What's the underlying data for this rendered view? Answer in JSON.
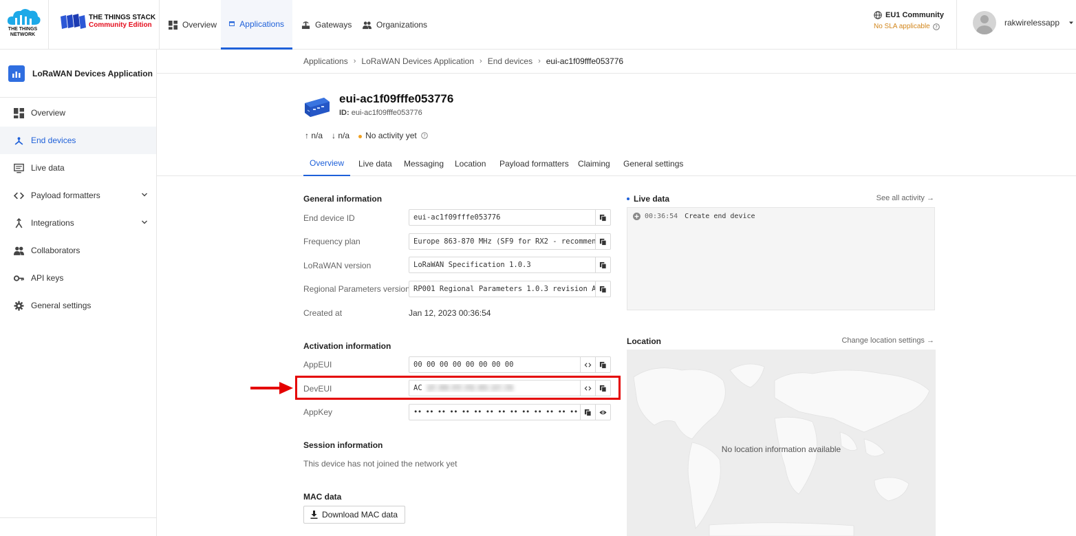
{
  "header": {
    "ttn_logo_text": "THE THINGS NETWORK",
    "stack_title": "THE THINGS STACK",
    "stack_edition": "Community Edition",
    "nav": [
      {
        "label": "Overview",
        "icon": "grid-icon"
      },
      {
        "label": "Applications",
        "icon": "window-icon",
        "active": true
      },
      {
        "label": "Gateways",
        "icon": "gateway-icon"
      },
      {
        "label": "Organizations",
        "icon": "people-icon"
      }
    ],
    "cluster": "EU1 Community",
    "sla": "No SLA applicable",
    "username": "rakwirelessapp"
  },
  "sidebar": {
    "app_name": "LoRaWAN Devices Application",
    "items": [
      {
        "label": "Overview",
        "icon": "grid-icon"
      },
      {
        "label": "End devices",
        "icon": "end-devices-icon",
        "active": true
      },
      {
        "label": "Live data",
        "icon": "live-data-icon"
      },
      {
        "label": "Payload formatters",
        "icon": "code-icon",
        "expandable": true
      },
      {
        "label": "Integrations",
        "icon": "integrations-icon",
        "expandable": true
      },
      {
        "label": "Collaborators",
        "icon": "people-icon"
      },
      {
        "label": "API keys",
        "icon": "key-icon"
      },
      {
        "label": "General settings",
        "icon": "gear-icon"
      }
    ]
  },
  "breadcrumbs": [
    "Applications",
    "LoRaWAN Devices Application",
    "End devices",
    "eui-ac1f09fffe053776"
  ],
  "device": {
    "title": "eui-ac1f09fffe053776",
    "id_label": "ID:",
    "id_value": "eui-ac1f09fffe053776",
    "uplink": "n/a",
    "downlink": "n/a",
    "activity": "No activity yet"
  },
  "tabs": [
    "Overview",
    "Live data",
    "Messaging",
    "Location",
    "Payload formatters",
    "Claiming",
    "General settings"
  ],
  "general": {
    "title": "General information",
    "end_device_id_label": "End device ID",
    "end_device_id": "eui-ac1f09fffe053776",
    "freq_label": "Frequency plan",
    "freq": "Europe 863-870 MHz (SF9 for RX2 - recommen…",
    "lorawan_label": "LoRaWAN version",
    "lorawan": "LoRaWAN Specification 1.0.3",
    "regional_label": "Regional Parameters version",
    "regional": "RP001 Regional Parameters 1.0.3 revision A",
    "created_label": "Created at",
    "created": "Jan 12, 2023 00:36:54"
  },
  "activation": {
    "title": "Activation information",
    "appeui_label": "AppEUI",
    "appeui": "00 00 00 00 00 00 00 00",
    "deveui_label": "DevEUI",
    "deveui_visible": "AC",
    "deveui_blurred": "1F 09 FF FE 05 37 76",
    "appkey_label": "AppKey",
    "appkey": "•• •• •• •• •• •• •• •• •• •• •• •• •• •• •• ••"
  },
  "session": {
    "title": "Session information",
    "text": "This device has not joined the network yet"
  },
  "mac": {
    "title": "MAC data",
    "button": "Download MAC data"
  },
  "live_data": {
    "title": "Live data",
    "see_all": "See all activity →",
    "events": [
      {
        "time": "00:36:54",
        "text": "Create end device"
      }
    ]
  },
  "location": {
    "title": "Location",
    "change": "Change location settings →",
    "empty": "No location information available"
  },
  "colors": {
    "accent": "#1e60d9",
    "highlight": "#e40000",
    "warning": "#d2861c"
  }
}
